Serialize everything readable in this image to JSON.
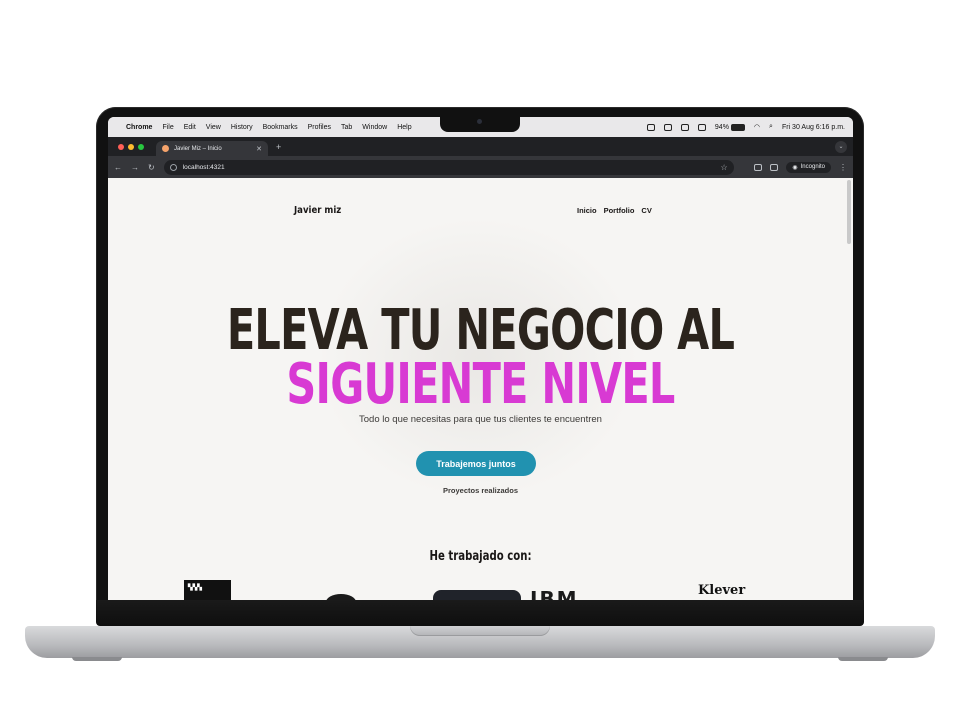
{
  "menubar": {
    "app": "Chrome",
    "items": [
      "File",
      "Edit",
      "View",
      "History",
      "Bookmarks",
      "Profiles",
      "Tab",
      "Window",
      "Help"
    ],
    "battery": "94%",
    "datetime": "Fri 30 Aug  6:16 p.m."
  },
  "browser": {
    "tab_title": "Javier Miz – Inicio",
    "url": "localhost:4321",
    "incognito_label": "Incognito"
  },
  "site": {
    "brand": "Javier miz",
    "nav": [
      "Inicio",
      "Portfolio",
      "CV"
    ],
    "hero_line1": "ELEVA TU NEGOCIO AL",
    "hero_line2": "SIGUIENTE NIVEL",
    "subtitle": "Todo lo que necesitas para que tus clientes te encuentren",
    "cta": "Trabajemos juntos",
    "secondary_link": "Proyectos realizados",
    "worked_with": "He trabajado con:",
    "logos": [
      "home-depot-logo",
      "round-logo",
      "dark-logo",
      "IBM",
      "Klever"
    ],
    "colors": {
      "accent": "#d83ad3",
      "button": "#2192b0",
      "text": "#2b241d"
    }
  }
}
